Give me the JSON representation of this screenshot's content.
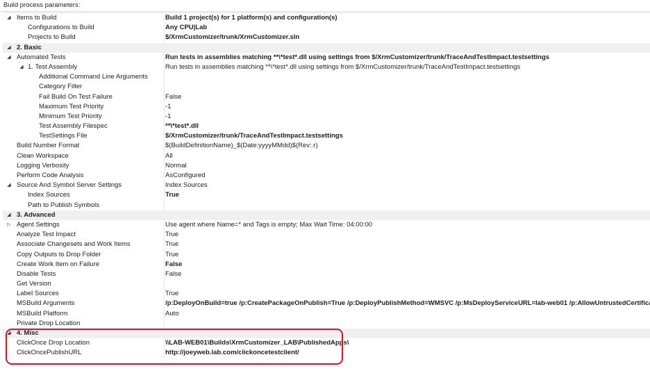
{
  "header": {
    "title": "Build process parameters:"
  },
  "rows": [
    {
      "level": 0,
      "type": "prop",
      "expander": "collapse",
      "name": "Items to Build",
      "value": "Build 1 project(s) for 1 platform(s) and configuration(s)",
      "bold": true
    },
    {
      "level": 1,
      "type": "prop",
      "expander": "",
      "name": "Configurations to Build",
      "value": "Any CPU|Lab",
      "bold": true
    },
    {
      "level": 1,
      "type": "prop",
      "expander": "",
      "name": "Projects to Build",
      "value": "$/XrmCustomizer/trunk/XrmCustomizer.sln",
      "bold": true
    },
    {
      "level": 0,
      "type": "category",
      "expander": "collapse",
      "name": "2. Basic",
      "value": "",
      "bold": true
    },
    {
      "level": 0,
      "type": "prop",
      "expander": "collapse",
      "name": "Automated Tests",
      "value": "Run tests in assemblies matching **\\*test*.dll using settings from $/XrmCustomizer/trunk/TraceAndTestImpact.testsettings",
      "bold": true
    },
    {
      "level": 1,
      "type": "prop",
      "expander": "collapse",
      "name": "1. Test Assembly",
      "value": "Run tests in assemblies matching **\\*test*.dll using settings from $/XrmCustomizer/trunk/TraceAndTestImpact.testsettings",
      "bold": false
    },
    {
      "level": 2,
      "type": "prop",
      "expander": "",
      "name": "Additional Command Line Arguments",
      "value": "",
      "bold": false
    },
    {
      "level": 2,
      "type": "prop",
      "expander": "",
      "name": "Category Filter",
      "value": "",
      "bold": false
    },
    {
      "level": 2,
      "type": "prop",
      "expander": "",
      "name": "Fail Build On Test Failure",
      "value": "False",
      "bold": false
    },
    {
      "level": 2,
      "type": "prop",
      "expander": "",
      "name": "Maximum Test Priority",
      "value": "-1",
      "bold": false
    },
    {
      "level": 2,
      "type": "prop",
      "expander": "",
      "name": "Minimum Test Priority",
      "value": "-1",
      "bold": false
    },
    {
      "level": 2,
      "type": "prop",
      "expander": "",
      "name": "Test Assembly Filespec",
      "value": "**\\*test*.dll",
      "bold": true
    },
    {
      "level": 2,
      "type": "prop",
      "expander": "",
      "name": "TestSettings File",
      "value": "$/XrmCustomizer/trunk/TraceAndTestImpact.testsettings",
      "bold": true
    },
    {
      "level": 0,
      "type": "prop",
      "expander": "",
      "name": "Build Number Format",
      "value": "$(BuildDefinitionName)_$(Date:yyyyMMdd)$(Rev:.r)",
      "bold": false
    },
    {
      "level": 0,
      "type": "prop",
      "expander": "",
      "name": "Clean Workspace",
      "value": "All",
      "bold": false
    },
    {
      "level": 0,
      "type": "prop",
      "expander": "",
      "name": "Logging Verbosity",
      "value": "Normal",
      "bold": false
    },
    {
      "level": 0,
      "type": "prop",
      "expander": "",
      "name": "Perform Code Analysis",
      "value": "AsConfigured",
      "bold": false
    },
    {
      "level": 0,
      "type": "prop",
      "expander": "collapse",
      "name": "Source And Symbol Server Settings",
      "value": "Index Sources",
      "bold": false
    },
    {
      "level": 1,
      "type": "prop",
      "expander": "",
      "name": "Index Sources",
      "value": "True",
      "bold": true
    },
    {
      "level": 1,
      "type": "prop",
      "expander": "",
      "name": "Path to Publish Symbols",
      "value": "",
      "bold": false
    },
    {
      "level": 0,
      "type": "category",
      "expander": "collapse",
      "name": "3. Advanced",
      "value": "",
      "bold": true
    },
    {
      "level": 0,
      "type": "prop",
      "expander": "expand",
      "name": "Agent Settings",
      "value": "Use agent where Name=* and Tags is empty; Max Wait Time: 04:00:00",
      "bold": false
    },
    {
      "level": 0,
      "type": "prop",
      "expander": "",
      "name": "Analyze Test Impact",
      "value": "True",
      "bold": false
    },
    {
      "level": 0,
      "type": "prop",
      "expander": "",
      "name": "Associate Changesets and Work Items",
      "value": "True",
      "bold": false
    },
    {
      "level": 0,
      "type": "prop",
      "expander": "",
      "name": "Copy Outputs to Drop Folder",
      "value": "True",
      "bold": false
    },
    {
      "level": 0,
      "type": "prop",
      "expander": "",
      "name": "Create Work Item on Failure",
      "value": "False",
      "bold": true
    },
    {
      "level": 0,
      "type": "prop",
      "expander": "",
      "name": "Disable Tests",
      "value": "False",
      "bold": false
    },
    {
      "level": 0,
      "type": "prop",
      "expander": "",
      "name": "Get Version",
      "value": "",
      "bold": false
    },
    {
      "level": 0,
      "type": "prop",
      "expander": "",
      "name": "Label Sources",
      "value": "True",
      "bold": false
    },
    {
      "level": 0,
      "type": "prop",
      "expander": "",
      "name": "MSBuild Arguments",
      "value": "/p:DeployOnBuild=true /p:CreatePackageOnPublish=True /p:DeployPublishMethod=WMSVC /p:MsDeployServiceURL=lab-web01 /p:AllowUntrustedCertificate=true",
      "bold": true
    },
    {
      "level": 0,
      "type": "prop",
      "expander": "",
      "name": "MSBuild Platform",
      "value": "Auto",
      "bold": false
    },
    {
      "level": 0,
      "type": "prop",
      "expander": "",
      "name": "Private Drop Location",
      "value": "",
      "bold": false
    },
    {
      "level": 0,
      "type": "category",
      "expander": "collapse",
      "name": "4. Misc",
      "value": "",
      "bold": true
    },
    {
      "level": 0,
      "type": "prop",
      "expander": "",
      "name": "ClickOnce Drop Location",
      "value": "\\\\LAB-WEB01\\Builds\\XrmCustomizer_LAB\\PublishedApps\\",
      "bold": true
    },
    {
      "level": 0,
      "type": "prop",
      "expander": "",
      "name": "ClickOncePublishURL",
      "value": "http://joeyweb.lab.com/clickoncetestclient/",
      "bold": true
    }
  ],
  "colors": {
    "highlight": "#d9142a",
    "category_bg": "#f0f0f0"
  }
}
